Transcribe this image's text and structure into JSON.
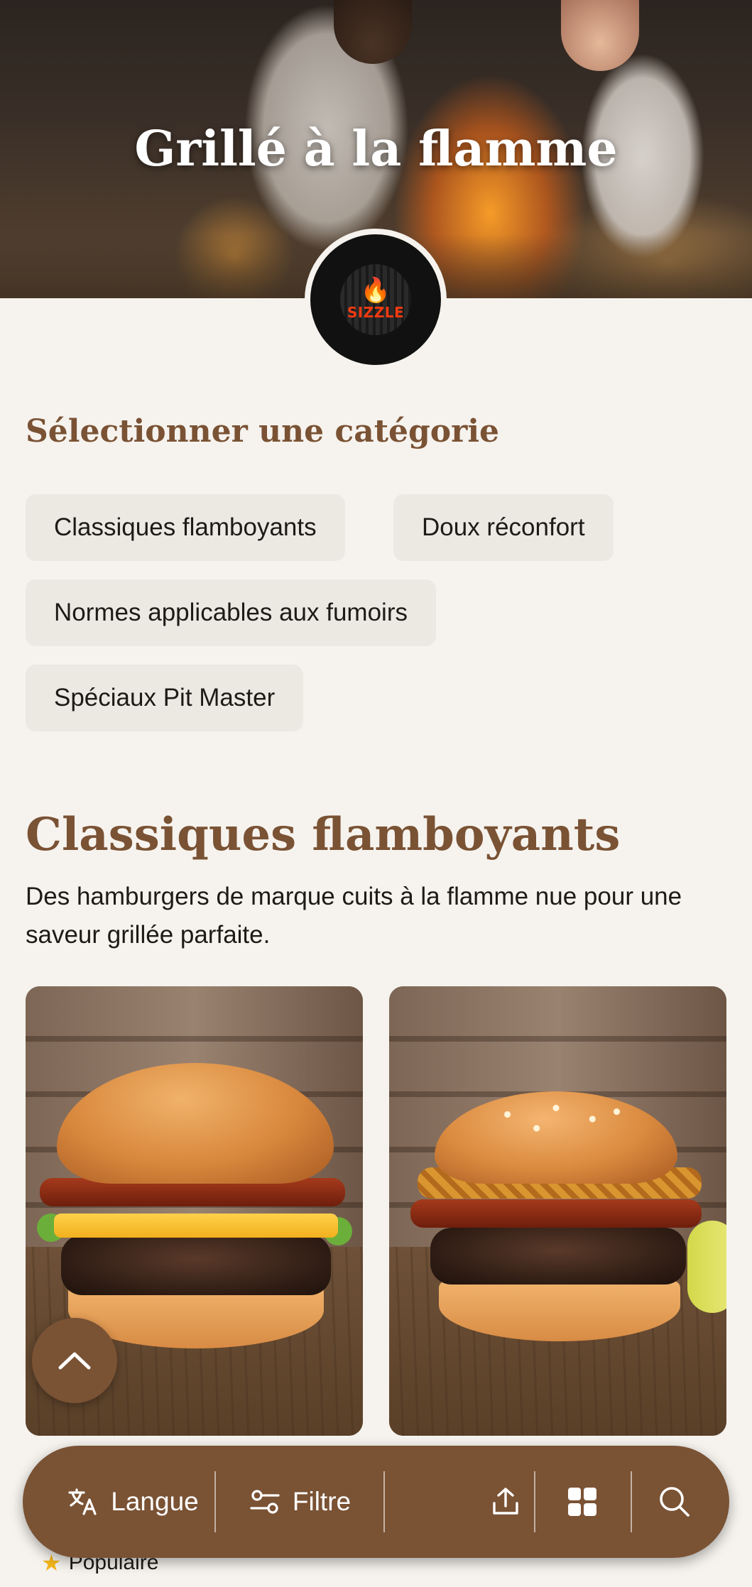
{
  "hero": {
    "title": "Grillé à la flamme"
  },
  "logo": {
    "text": "SIZZLE"
  },
  "categories": {
    "heading": "Sélectionner une catégorie",
    "items": [
      "Classiques flamboyants",
      "Doux réconfort",
      "Normes applicables aux fumoirs",
      "Spéciaux Pit Master"
    ]
  },
  "section": {
    "title": "Classiques flamboyants",
    "description": "Des hamburgers de marque cuits à la flamme nue pour une saveur grillée parfaite."
  },
  "cards": [
    {
      "badge": "Populaire",
      "image": "bacon-cheeseburger"
    },
    {
      "image": "bacon-onion-burger"
    }
  ],
  "bottom_bar": {
    "language_label": "Langue",
    "filter_label": "Filtre",
    "icons": [
      "translate-icon",
      "filter-icon",
      "share-icon",
      "grid-icon",
      "search-icon"
    ]
  },
  "colors": {
    "accent": "#7a5234",
    "background": "#f6f3ee",
    "chip_bg": "#ece8e2",
    "star": "#f3b51c"
  }
}
